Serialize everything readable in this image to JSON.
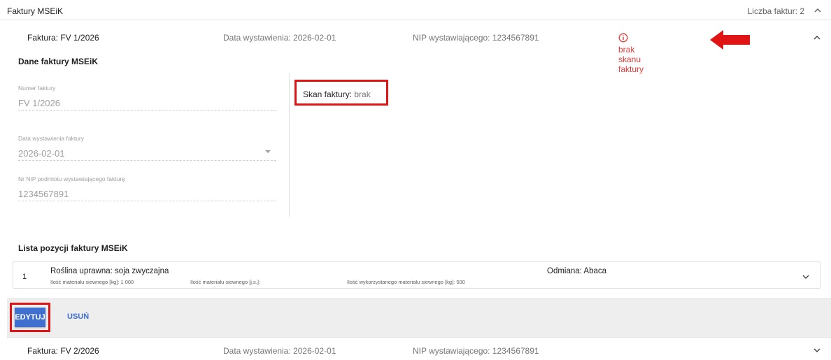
{
  "header": {
    "title": "Faktury MSEiK",
    "count_text": "Liczba faktur: 2",
    "collapse_icon": "chevron-up-icon"
  },
  "invoice1": {
    "invoice_label": "Faktura: FV 1/2026",
    "date_label": "Data wystawienia: 2026-02-01",
    "nip_label": "NIP wystawiającego: 1234567891",
    "warning_text": "brak skanu faktury",
    "warning_icon": "info-circle-icon",
    "warning_color": "#e53935",
    "expand_icon": "chevron-up-icon",
    "details_title": "Dane faktury MSEiK",
    "fields": [
      {
        "label": "Numer faktury",
        "value": "FV 1/2026"
      },
      {
        "label": "Data wystawienia faktury",
        "value": "2026-02-01"
      },
      {
        "label": "Nr NIP podmiotu wystawiającego fakturę",
        "value": "1234567891"
      }
    ],
    "scan_key": "Skan faktury:",
    "scan_value": "brak",
    "positions_title": "Lista pozycji faktury MSEiK",
    "positions": [
      {
        "number": "1",
        "crop": "Roślina uprawna: soja zwyczajna",
        "variety": "Odmiana: Abaca",
        "seed_kg": "Ilość materiału siewnego [kg]: 1 000",
        "seed_units": "Ilość materiału siewnego [j.s.]:",
        "used_kg": "Ilość wykorzystanego materiału siewnego [kg]: 500"
      }
    ],
    "edit_label": "EDYTUJ",
    "delete_label": "USUŃ",
    "accent_color": "#3f6fcf",
    "highlight_color": "#e01414"
  },
  "invoice2": {
    "invoice_label": "Faktura: FV 2/2026",
    "date_label": "Data wystawienia: 2026-02-01",
    "nip_label": "NIP wystawiającego: 1234567891",
    "expand_icon": "chevron-down-icon"
  }
}
